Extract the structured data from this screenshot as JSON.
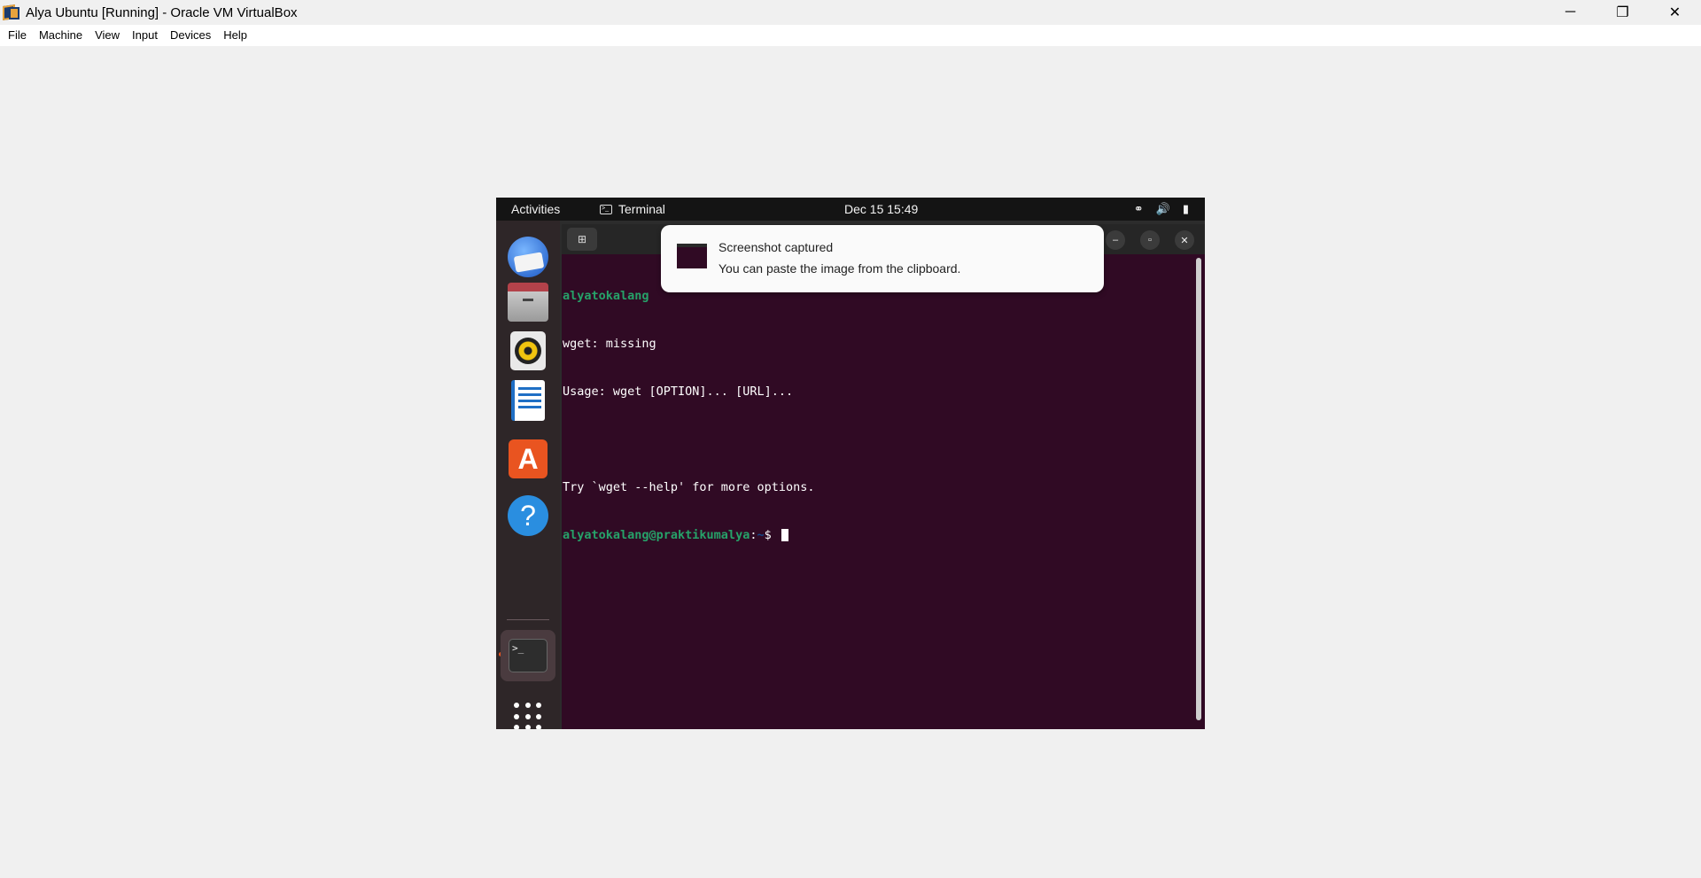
{
  "host": {
    "title": "Alya Ubuntu [Running] - Oracle VM VirtualBox",
    "controls": {
      "minimize": "─",
      "restore": "❐",
      "close": "✕"
    },
    "menu": [
      "File",
      "Machine",
      "View",
      "Input",
      "Devices",
      "Help"
    ]
  },
  "vm": {
    "topbar": {
      "activities": "Activities",
      "app_indicator": "Terminal",
      "app_indicator_icon": ">_",
      "clock": "Dec 15  15:49",
      "tray": {
        "network": "⚭",
        "volume": "🔊",
        "battery": "▮"
      }
    },
    "dock": {
      "items": [
        "thunderbird-icon",
        "files-icon",
        "rhythmbox-icon",
        "libreoffice-writer-icon",
        "app-center-icon",
        "help-icon",
        "terminal-icon",
        "show-apps-icon"
      ],
      "help_glyph": "?",
      "store_glyph": "A",
      "terminal_glyph": ">_"
    },
    "terminal": {
      "newtab_glyph": "⊞",
      "controls": {
        "minimize": "–",
        "maximize": "▫",
        "close": "✕"
      },
      "lines": [
        {
          "user": "alyatokalang",
          "rest": ""
        },
        {
          "text": "wget: missing"
        },
        {
          "text": "Usage: wget [OPTION]... [URL]..."
        },
        {
          "text": ""
        },
        {
          "text": "Try `wget --help' for more options."
        }
      ],
      "prompt": {
        "user": "alyatokalang@praktikumalya",
        "sep": ":",
        "path": "~",
        "symbol": "$ "
      }
    },
    "notification": {
      "title": "Screenshot captured",
      "body": "You can paste the image from the clipboard."
    }
  }
}
